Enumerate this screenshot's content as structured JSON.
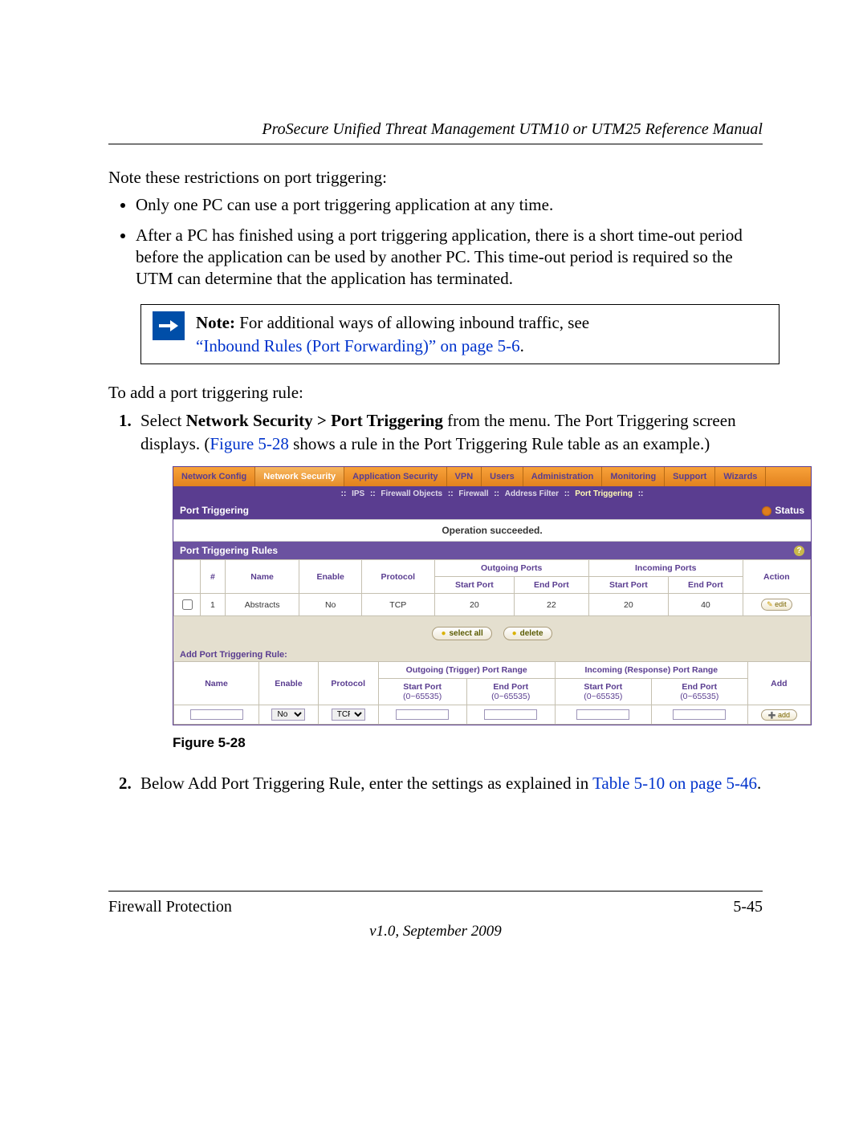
{
  "header": {
    "title": "ProSecure Unified Threat Management UTM10 or UTM25 Reference Manual"
  },
  "intro": {
    "lead": "Note these restrictions on port triggering:",
    "bullets": [
      "Only one PC can use a port triggering application at any time.",
      "After a PC has finished using a port triggering application, there is a short time-out period before the application can be used by another PC. This time-out period is required so the UTM can determine that the application has terminated."
    ]
  },
  "note": {
    "prefix": "Note:",
    "body": " For additional ways of allowing inbound traffic, see ",
    "link": "“Inbound Rules (Port Forwarding)” on page 5-6",
    "suffix": "."
  },
  "add_intro": "To add a port triggering rule:",
  "step1": {
    "pre": "Select ",
    "bold": "Network Security > Port Triggering",
    "mid": " from the menu. The Port Triggering screen displays. (",
    "link": "Figure 5-28",
    "post": " shows a rule in the Port Triggering Rule table as an example.)"
  },
  "figure": {
    "tabs": [
      "Network Config",
      "Network Security",
      "Application Security",
      "VPN",
      "Users",
      "Administration",
      "Monitoring",
      "Support",
      "Wizards"
    ],
    "subtabs_prefix": ":: ",
    "subtabs": [
      "IPS",
      "Firewall Objects",
      "Firewall",
      "Address Filter",
      "Port Triggering"
    ],
    "section_title": "Port Triggering",
    "status_label": "Status",
    "operation_msg": "Operation succeeded.",
    "rules_header": "Port Triggering Rules",
    "cols": {
      "idx": "#",
      "name": "Name",
      "enable": "Enable",
      "protocol": "Protocol",
      "outgoing": "Outgoing Ports",
      "incoming": "Incoming Ports",
      "start": "Start Port",
      "end": "End Port",
      "action": "Action"
    },
    "row": {
      "idx": "1",
      "name": "Abstracts",
      "enable": "No",
      "protocol": "TCP",
      "out_start": "20",
      "out_end": "22",
      "in_start": "20",
      "in_end": "40",
      "edit": "edit"
    },
    "btn_select_all": "select all",
    "btn_delete": "delete",
    "add_header": "Add Port Triggering Rule:",
    "add_cols": {
      "name": "Name",
      "enable": "Enable",
      "protocol": "Protocol",
      "out_range": "Outgoing (Trigger) Port Range",
      "in_range": "Incoming (Response) Port Range",
      "add": "Add"
    },
    "range_hint": "(0~65535)",
    "enable_opts": "No",
    "proto_opts": "TCP",
    "add_btn": "add"
  },
  "caption": "Figure 5-28",
  "step2": {
    "pre": "Below Add Port Triggering Rule, enter the settings as explained in ",
    "link": "Table 5-10 on page 5-46",
    "post": "."
  },
  "footer": {
    "left": "Firewall Protection",
    "right": "5-45",
    "version": "v1.0, September 2009"
  }
}
